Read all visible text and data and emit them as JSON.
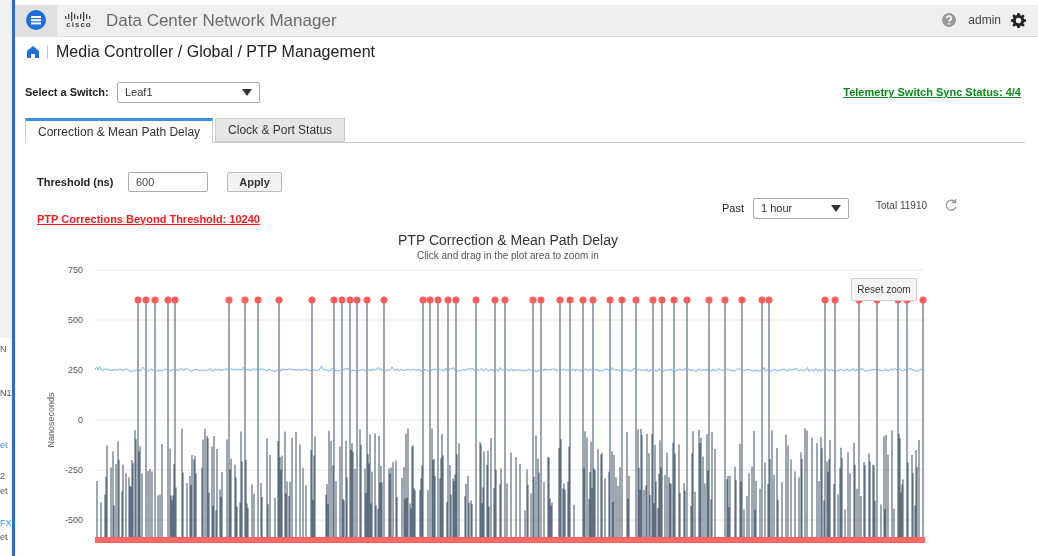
{
  "header": {
    "logo_text": "cisco",
    "app_title": "Data Center Network Manager",
    "user": "admin"
  },
  "breadcrumb": "Media Controller / Global / PTP Management",
  "switch_select": {
    "label": "Select a Switch:",
    "value": "Leaf1"
  },
  "sync_status_link": "Telemetry Switch Sync Status: 4/4",
  "tabs": [
    {
      "label": "Correction & Mean Path Delay",
      "selected": true
    },
    {
      "label": "Clock & Port Status",
      "selected": false
    }
  ],
  "threshold": {
    "label": "Threshold (ns)",
    "value": "600",
    "button": "Apply"
  },
  "beyond_threshold_link": "PTP Corrections Beyond Threshold: 10240",
  "period": {
    "label": "Past",
    "value": "1 hour"
  },
  "total": "Total 11910",
  "chart": {
    "title": "PTP Correction & Mean Path Delay",
    "subtitle": "Click and drag in the plot area to zoom in",
    "ylabel": "Nanoseconds",
    "yticks": [
      "750",
      "500",
      "250",
      "0",
      "-250",
      "-500"
    ],
    "reset_button": "Reset zoom"
  },
  "background_fragments": [
    "N",
    "N1",
    "et",
    "2",
    "et",
    "FX",
    "et"
  ]
}
